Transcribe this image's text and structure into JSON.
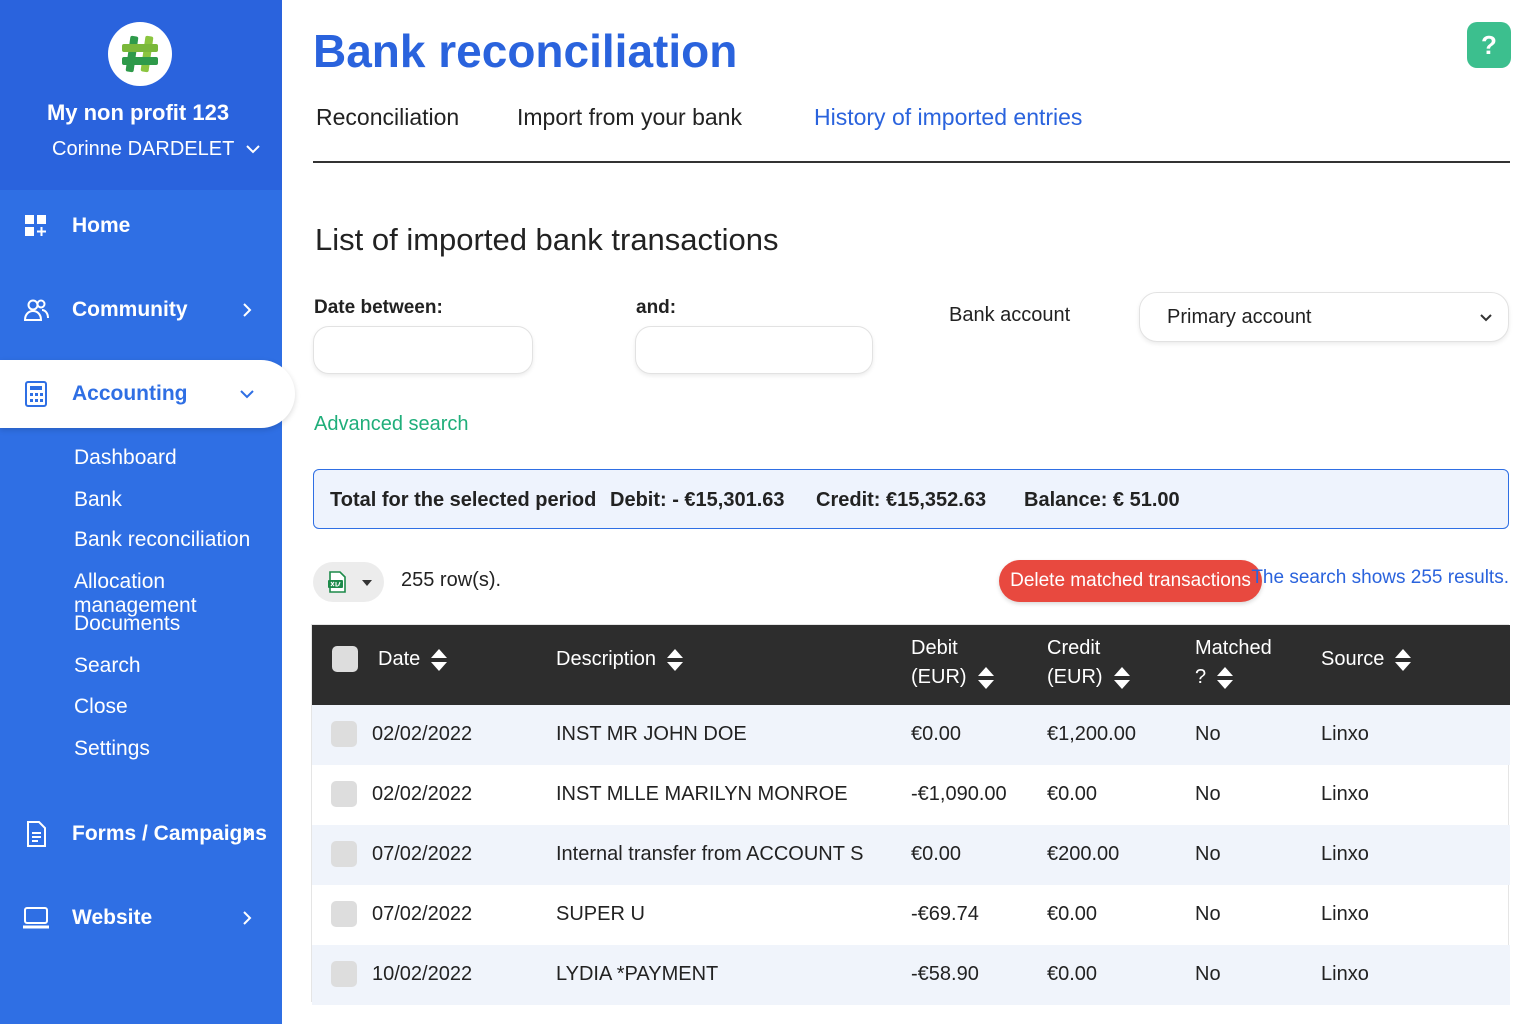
{
  "sidebar": {
    "org_name": "My non profit 123",
    "user_name": "Corinne DARDELET",
    "nav": {
      "home": "Home",
      "community": "Community",
      "accounting": "Accounting",
      "forms": "Forms / Campaigns",
      "website": "Website"
    },
    "accounting_sub": [
      "Dashboard",
      "Bank",
      "Bank reconciliation",
      "Allocation management",
      "Documents",
      "Search",
      "Close",
      "Settings"
    ]
  },
  "header": {
    "title": "Bank reconciliation",
    "help": "?",
    "tabs": [
      "Reconciliation",
      "Import from your bank",
      "History of imported entries"
    ],
    "active_tab_index": 2
  },
  "filters": {
    "section_title": "List of imported bank transactions",
    "date_between_label": "Date between:",
    "date_from": "",
    "and_label": "and:",
    "date_to": "",
    "bank_account_label": "Bank account",
    "bank_account_value": "Primary account",
    "advanced_search": "Advanced search"
  },
  "totals": {
    "label": "Total for the selected period",
    "debit": "Debit: - €15,301.63",
    "credit": "Credit: €15,352.63",
    "balance": "Balance: € 51.00"
  },
  "toolbar": {
    "row_count": "255 row(s).",
    "delete_button": "Delete matched transactions",
    "search_results": "The search shows 255 results."
  },
  "table": {
    "headers": {
      "date": "Date",
      "description": "Description",
      "debit_l1": "Debit",
      "debit_l2": "(EUR)",
      "credit_l1": "Credit",
      "credit_l2": "(EUR)",
      "matched_l1": "Matched",
      "matched_l2": "?",
      "source": "Source"
    },
    "rows": [
      {
        "date": "02/02/2022",
        "description": "INST MR JOHN DOE",
        "debit": "€0.00",
        "credit": "€1,200.00",
        "matched": "No",
        "source": "Linxo"
      },
      {
        "date": "02/02/2022",
        "description": "INST MLLE MARILYN MONROE",
        "debit": "-€1,090.00",
        "credit": "€0.00",
        "matched": "No",
        "source": "Linxo"
      },
      {
        "date": "07/02/2022",
        "description": "Internal transfer from ACCOUNT S",
        "debit": "€0.00",
        "credit": "€200.00",
        "matched": "No",
        "source": "Linxo"
      },
      {
        "date": "07/02/2022",
        "description": "SUPER U",
        "debit": "-€69.74",
        "credit": "€0.00",
        "matched": "No",
        "source": "Linxo"
      },
      {
        "date": "10/02/2022",
        "description": "LYDIA *PAYMENT",
        "debit": "-€58.90",
        "credit": "€0.00",
        "matched": "No",
        "source": "Linxo"
      }
    ]
  },
  "colors": {
    "sidebar": "#2f6fe4",
    "accent": "#2a63dd",
    "link_green": "#1fae7a",
    "danger": "#e8493f",
    "help": "#3cbf8e",
    "table_header": "#2d2d2d"
  }
}
